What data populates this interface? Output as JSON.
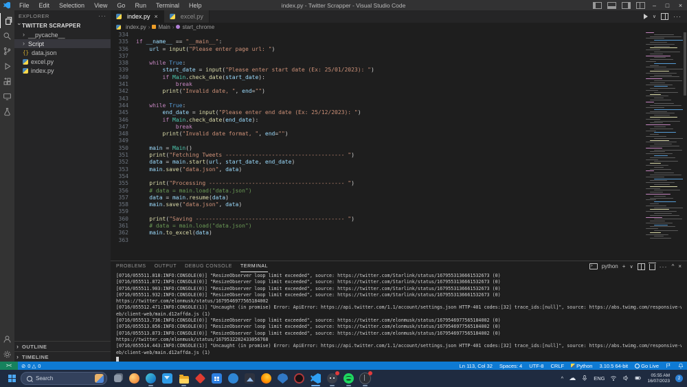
{
  "window": {
    "title": "index.py - Twitter Scrapper - Visual Studio Code"
  },
  "icons": {
    "close": "×",
    "more": "···",
    "plus": "+",
    "chevron_down": "∨",
    "chevron_up": "^",
    "minimize": "–",
    "maximize": "□",
    "remote": "><",
    "cloud": "☁",
    "collapsed": "›",
    "question": "?",
    "json_braces": "{}"
  },
  "menubar": {
    "items": [
      "File",
      "Edit",
      "Selection",
      "View",
      "Go",
      "Run",
      "Terminal",
      "Help"
    ]
  },
  "explorer": {
    "header": "EXPLORER",
    "root": "TWITTER SCRAPPER",
    "items": [
      {
        "label": "__pycache__",
        "type": "folder",
        "selected": false
      },
      {
        "label": "Script",
        "type": "folder",
        "selected": true
      },
      {
        "label": "data.json",
        "type": "json",
        "selected": false
      },
      {
        "label": "excel.py",
        "type": "python",
        "selected": false
      },
      {
        "label": "index.py",
        "type": "python",
        "selected": false
      }
    ],
    "bottom_sections": [
      "OUTLINE",
      "TIMELINE"
    ]
  },
  "tabs": [
    {
      "label": "index.py",
      "active": true
    },
    {
      "label": "excel.py",
      "active": false
    }
  ],
  "breadcrumb": {
    "file": "index.py",
    "symbol1": "Main",
    "symbol2": "start_chrome",
    "separator": "›"
  },
  "editor": {
    "lines": [
      {
        "n": 334,
        "t": []
      },
      {
        "n": 335,
        "t": [
          [
            "kw",
            "if"
          ],
          [
            "pl",
            " "
          ],
          [
            "vr",
            "__name__"
          ],
          [
            "pl",
            " == "
          ],
          [
            "st",
            "\"__main__\""
          ],
          [
            "pl",
            ":"
          ]
        ]
      },
      {
        "n": 336,
        "t": [
          [
            "pl",
            "    "
          ],
          [
            "vr",
            "url"
          ],
          [
            "pl",
            " = "
          ],
          [
            "fn",
            "input"
          ],
          [
            "pl",
            "("
          ],
          [
            "st",
            "\"Please enter page url: \""
          ],
          [
            "pl",
            ")"
          ]
        ]
      },
      {
        "n": 337,
        "t": []
      },
      {
        "n": 338,
        "t": [
          [
            "pl",
            "    "
          ],
          [
            "kw",
            "while"
          ],
          [
            "pl",
            " "
          ],
          [
            "cn",
            "True"
          ],
          [
            "pl",
            ":"
          ]
        ]
      },
      {
        "n": 339,
        "t": [
          [
            "pl",
            "        "
          ],
          [
            "vr",
            "start_date"
          ],
          [
            "pl",
            " = "
          ],
          [
            "fn",
            "input"
          ],
          [
            "pl",
            "("
          ],
          [
            "st",
            "\"Please enter start date (Ex: 25/01/2023): \""
          ],
          [
            "pl",
            ")"
          ]
        ]
      },
      {
        "n": 340,
        "t": [
          [
            "pl",
            "        "
          ],
          [
            "kw",
            "if"
          ],
          [
            "pl",
            " "
          ],
          [
            "cs",
            "Main"
          ],
          [
            "pl",
            "."
          ],
          [
            "fn",
            "check_date"
          ],
          [
            "pl",
            "("
          ],
          [
            "vr",
            "start_date"
          ],
          [
            "pl",
            "):"
          ]
        ]
      },
      {
        "n": 341,
        "t": [
          [
            "pl",
            "            "
          ],
          [
            "kw",
            "break"
          ]
        ]
      },
      {
        "n": 342,
        "t": [
          [
            "pl",
            "        "
          ],
          [
            "fn",
            "print"
          ],
          [
            "pl",
            "("
          ],
          [
            "st",
            "\"Invalid date, \""
          ],
          [
            "pl",
            ", "
          ],
          [
            "vr",
            "end"
          ],
          [
            "pl",
            "="
          ],
          [
            "st",
            "\"\""
          ],
          [
            "pl",
            ")"
          ]
        ]
      },
      {
        "n": 343,
        "t": []
      },
      {
        "n": 344,
        "t": [
          [
            "pl",
            "    "
          ],
          [
            "kw",
            "while"
          ],
          [
            "pl",
            " "
          ],
          [
            "cn",
            "True"
          ],
          [
            "pl",
            ":"
          ]
        ]
      },
      {
        "n": 345,
        "t": [
          [
            "pl",
            "        "
          ],
          [
            "vr",
            "end_date"
          ],
          [
            "pl",
            " = "
          ],
          [
            "fn",
            "input"
          ],
          [
            "pl",
            "("
          ],
          [
            "st",
            "\"Please enter end date (Ex: 25/12/2023): \""
          ],
          [
            "pl",
            ")"
          ]
        ]
      },
      {
        "n": 346,
        "t": [
          [
            "pl",
            "        "
          ],
          [
            "kw",
            "if"
          ],
          [
            "pl",
            " "
          ],
          [
            "cs",
            "Main"
          ],
          [
            "pl",
            "."
          ],
          [
            "fn",
            "check_date"
          ],
          [
            "pl",
            "("
          ],
          [
            "vr",
            "end_date"
          ],
          [
            "pl",
            "):"
          ]
        ]
      },
      {
        "n": 347,
        "t": [
          [
            "pl",
            "            "
          ],
          [
            "kw",
            "break"
          ]
        ]
      },
      {
        "n": 348,
        "t": [
          [
            "pl",
            "        "
          ],
          [
            "fn",
            "print"
          ],
          [
            "pl",
            "("
          ],
          [
            "st",
            "\"Invalid date format, \""
          ],
          [
            "pl",
            ", "
          ],
          [
            "vr",
            "end"
          ],
          [
            "pl",
            "="
          ],
          [
            "st",
            "\"\""
          ],
          [
            "pl",
            ")"
          ]
        ]
      },
      {
        "n": 349,
        "t": []
      },
      {
        "n": 350,
        "t": [
          [
            "pl",
            "    "
          ],
          [
            "vr",
            "main"
          ],
          [
            "pl",
            " = "
          ],
          [
            "cs",
            "Main"
          ],
          [
            "pl",
            "()"
          ]
        ]
      },
      {
        "n": 351,
        "t": [
          [
            "pl",
            "    "
          ],
          [
            "fn",
            "print"
          ],
          [
            "pl",
            "("
          ],
          [
            "st",
            "\"Fetching Tweets ------------------------------------ \""
          ],
          [
            "pl",
            ")"
          ]
        ]
      },
      {
        "n": 352,
        "t": [
          [
            "pl",
            "    "
          ],
          [
            "vr",
            "data"
          ],
          [
            "pl",
            " = "
          ],
          [
            "vr",
            "main"
          ],
          [
            "pl",
            "."
          ],
          [
            "fn",
            "start"
          ],
          [
            "pl",
            "("
          ],
          [
            "vr",
            "url"
          ],
          [
            "pl",
            ", "
          ],
          [
            "vr",
            "start_date"
          ],
          [
            "pl",
            ", "
          ],
          [
            "vr",
            "end_date"
          ],
          [
            "pl",
            ")"
          ]
        ]
      },
      {
        "n": 353,
        "t": [
          [
            "pl",
            "    "
          ],
          [
            "vr",
            "main"
          ],
          [
            "pl",
            "."
          ],
          [
            "fn",
            "save"
          ],
          [
            "pl",
            "("
          ],
          [
            "st",
            "\"data.json\""
          ],
          [
            "pl",
            ", "
          ],
          [
            "vr",
            "data"
          ],
          [
            "pl",
            ")"
          ]
        ]
      },
      {
        "n": 354,
        "t": []
      },
      {
        "n": 355,
        "t": [
          [
            "pl",
            "    "
          ],
          [
            "fn",
            "print"
          ],
          [
            "pl",
            "("
          ],
          [
            "st",
            "\"Processing ----------------------------------------- \""
          ],
          [
            "pl",
            ")"
          ]
        ]
      },
      {
        "n": 356,
        "t": [
          [
            "pl",
            "    "
          ],
          [
            "cm",
            "# data = main.load(\"data.json\")"
          ]
        ]
      },
      {
        "n": 357,
        "t": [
          [
            "pl",
            "    "
          ],
          [
            "vr",
            "data"
          ],
          [
            "pl",
            " = "
          ],
          [
            "vr",
            "main"
          ],
          [
            "pl",
            "."
          ],
          [
            "fn",
            "resume"
          ],
          [
            "pl",
            "("
          ],
          [
            "vr",
            "data"
          ],
          [
            "pl",
            ")"
          ]
        ]
      },
      {
        "n": 358,
        "t": [
          [
            "pl",
            "    "
          ],
          [
            "vr",
            "main"
          ],
          [
            "pl",
            "."
          ],
          [
            "fn",
            "save"
          ],
          [
            "pl",
            "("
          ],
          [
            "st",
            "\"data.json\""
          ],
          [
            "pl",
            ", "
          ],
          [
            "vr",
            "data"
          ],
          [
            "pl",
            ")"
          ]
        ]
      },
      {
        "n": 359,
        "t": []
      },
      {
        "n": 360,
        "t": [
          [
            "pl",
            "    "
          ],
          [
            "fn",
            "print"
          ],
          [
            "pl",
            "("
          ],
          [
            "st",
            "\"Saving --------------------------------------------- \""
          ],
          [
            "pl",
            ")"
          ]
        ]
      },
      {
        "n": 361,
        "t": [
          [
            "pl",
            "    "
          ],
          [
            "cm",
            "# data = main.load(\"data.json\")"
          ]
        ]
      },
      {
        "n": 362,
        "t": [
          [
            "pl",
            "    "
          ],
          [
            "vr",
            "main"
          ],
          [
            "pl",
            "."
          ],
          [
            "fn",
            "to_excel"
          ],
          [
            "pl",
            "("
          ],
          [
            "vr",
            "data"
          ],
          [
            "pl",
            ")"
          ]
        ]
      },
      {
        "n": 363,
        "t": []
      }
    ]
  },
  "panel": {
    "tabs": [
      "PROBLEMS",
      "OUTPUT",
      "DEBUG CONSOLE",
      "TERMINAL"
    ],
    "active_tab": "TERMINAL",
    "shell_label": "python",
    "terminal_lines": [
      "[0716/055511.818:INFO:CONSOLE(0)] \"ResizeObserver loop limit exceeded\", source: https://twitter.com/Starlink/status/1679553136661532673 (0)",
      "[0716/055511.872:INFO:CONSOLE(0)] \"ResizeObserver loop limit exceeded\", source: https://twitter.com/Starlink/status/1679553136661532673 (0)",
      "[0716/055511.903:INFO:CONSOLE(0)] \"ResizeObserver loop limit exceeded\", source: https://twitter.com/Starlink/status/1679553136661532673 (0)",
      "[0716/055511.932:INFO:CONSOLE(0)] \"ResizeObserver loop limit exceeded\", source: https://twitter.com/Starlink/status/1679553136661532673 (0)",
      "https://twitter.com/elonmusk/status/1679546977565184002",
      "[0716/055512.471:INFO:CONSOLE(1)] \"Uncaught (in promise) Error: ApiError: https://api.twitter.com/1.1/account/settings.json HTTP-401 codes:[32] trace_ids:[null]\", source: https://abs.twimg.com/responsive-w",
      "eb/client-web/main.d12affda.js (1)",
      "[0716/055513.736:INFO:CONSOLE(0)] \"ResizeObserver loop limit exceeded\", source: https://twitter.com/elonmusk/status/1679546977565184002 (0)",
      "[0716/055513.856:INFO:CONSOLE(0)] \"ResizeObserver loop limit exceeded\", source: https://twitter.com/elonmusk/status/1679546977565184002 (0)",
      "[0716/055513.873:INFO:CONSOLE(0)] \"ResizeObserver loop limit exceeded\", source: https://twitter.com/elonmusk/status/1679546977565184002 (0)",
      "https://twitter.com/elonmusk/status/1679532282433056768",
      "[0716/055514.443:INFO:CONSOLE(1)] \"Uncaught (in promise) Error: ApiError: https://api.twitter.com/1.1/account/settings.json HTTP-401 codes:[32] trace_ids:[null]\", source: https://abs.twimg.com/responsive-w",
      "eb/client-web/main.d12affda.js (1)"
    ]
  },
  "status_bar": {
    "errors": "0",
    "warnings": "0",
    "right": [
      "Ln 113, Col 32",
      "Spaces: 4",
      "UTF-8",
      "CRLF",
      "Python",
      "3.10.5 64-bit",
      "Go Live"
    ]
  },
  "taskbar": {
    "search_label": "Search",
    "apps": [
      {
        "name": "task-view",
        "running": false,
        "active": false,
        "badge": false
      },
      {
        "name": "widgets",
        "running": false,
        "active": false,
        "badge": false
      },
      {
        "name": "edge",
        "running": true,
        "active": false,
        "badge": false
      },
      {
        "name": "mail",
        "running": false,
        "active": false,
        "badge": false
      },
      {
        "name": "file-explorer",
        "running": true,
        "active": false,
        "badge": false
      },
      {
        "name": "app-diamond",
        "running": false,
        "active": false,
        "badge": false
      },
      {
        "name": "microsoft-store",
        "running": false,
        "active": false,
        "badge": false
      },
      {
        "name": "get-help",
        "running": false,
        "active": false,
        "badge": false
      },
      {
        "name": "media-app",
        "running": false,
        "active": false,
        "badge": false
      },
      {
        "name": "firefox",
        "running": false,
        "active": false,
        "badge": false
      },
      {
        "name": "security-app",
        "running": false,
        "active": false,
        "badge": false
      },
      {
        "name": "app-dark-ring",
        "running": false,
        "active": false,
        "badge": false
      },
      {
        "name": "vscode",
        "running": true,
        "active": true,
        "badge": false
      },
      {
        "name": "discord",
        "running": true,
        "active": false,
        "badge": true
      },
      {
        "name": "spotify",
        "running": true,
        "active": false,
        "badge": false
      },
      {
        "name": "game-app",
        "running": true,
        "active": false,
        "badge": true
      }
    ],
    "tray": {
      "language": "ENG",
      "time": "05:55 AM",
      "date": "16/07/2023",
      "notification_count": "2"
    }
  },
  "colors": {
    "accent": "#0e7ad3",
    "remote_green": "#16825d",
    "taskbar_bg": "#1f2b40",
    "minimap_palette": [
      "#5a5a5a",
      "#c586c0",
      "#ce9178",
      "#dcdcaa",
      "#4ec9b0",
      "#569cd6",
      "#6a9955"
    ]
  }
}
